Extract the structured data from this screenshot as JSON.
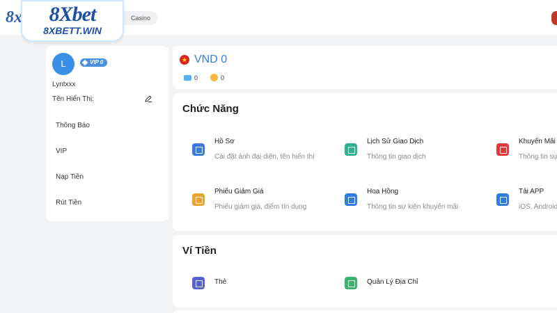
{
  "logo": {
    "main": "8Xbet",
    "sub": "8XBETT.WIN",
    "partial": "8x"
  },
  "topbar": {
    "casino_tab": "Casino"
  },
  "profile": {
    "avatar_letter": "L",
    "vip_label": "VIP 0",
    "username": "Lyntxxx",
    "display_name_label": "Tên Hiển Thị:"
  },
  "menu": {
    "items": [
      "Thông Báo",
      "VIP",
      "Nạp Tiền",
      "Rút Tiền"
    ]
  },
  "balance": {
    "flag": "★",
    "amount": "VND 0",
    "tickets": "0",
    "coins": "0"
  },
  "features": {
    "title": "Chức Năng",
    "items": [
      {
        "title": "Hồ Sơ",
        "desc": "Cài đặt ảnh đại diện, tên hiển thị",
        "color": "#3b7be0"
      },
      {
        "title": "Lịch Sử Giao Dịch",
        "desc": "Thông tin giao dịch",
        "color": "#2eb38e"
      },
      {
        "title": "Khuyến Mãi",
        "desc": "Thông tin sự",
        "color": "#e03b3b"
      },
      {
        "title": "Phiếu Giảm Giá",
        "desc": "Phiếu giảm giá, điểm tín dụng",
        "color": "#f0a12c"
      },
      {
        "title": "Hoa Hồng",
        "desc": "Thông tin sự kiện khuyến mãi",
        "color": "#2f7de1"
      },
      {
        "title": "Tải APP",
        "desc": "iOS, Android",
        "color": "#2f7de1"
      }
    ]
  },
  "wallet": {
    "title": "Ví Tiền",
    "items": [
      {
        "title": "Thẻ",
        "color": "#5b5fd6"
      },
      {
        "title": "Quản Lý Địa Chỉ",
        "color": "#3bb36a"
      }
    ]
  }
}
